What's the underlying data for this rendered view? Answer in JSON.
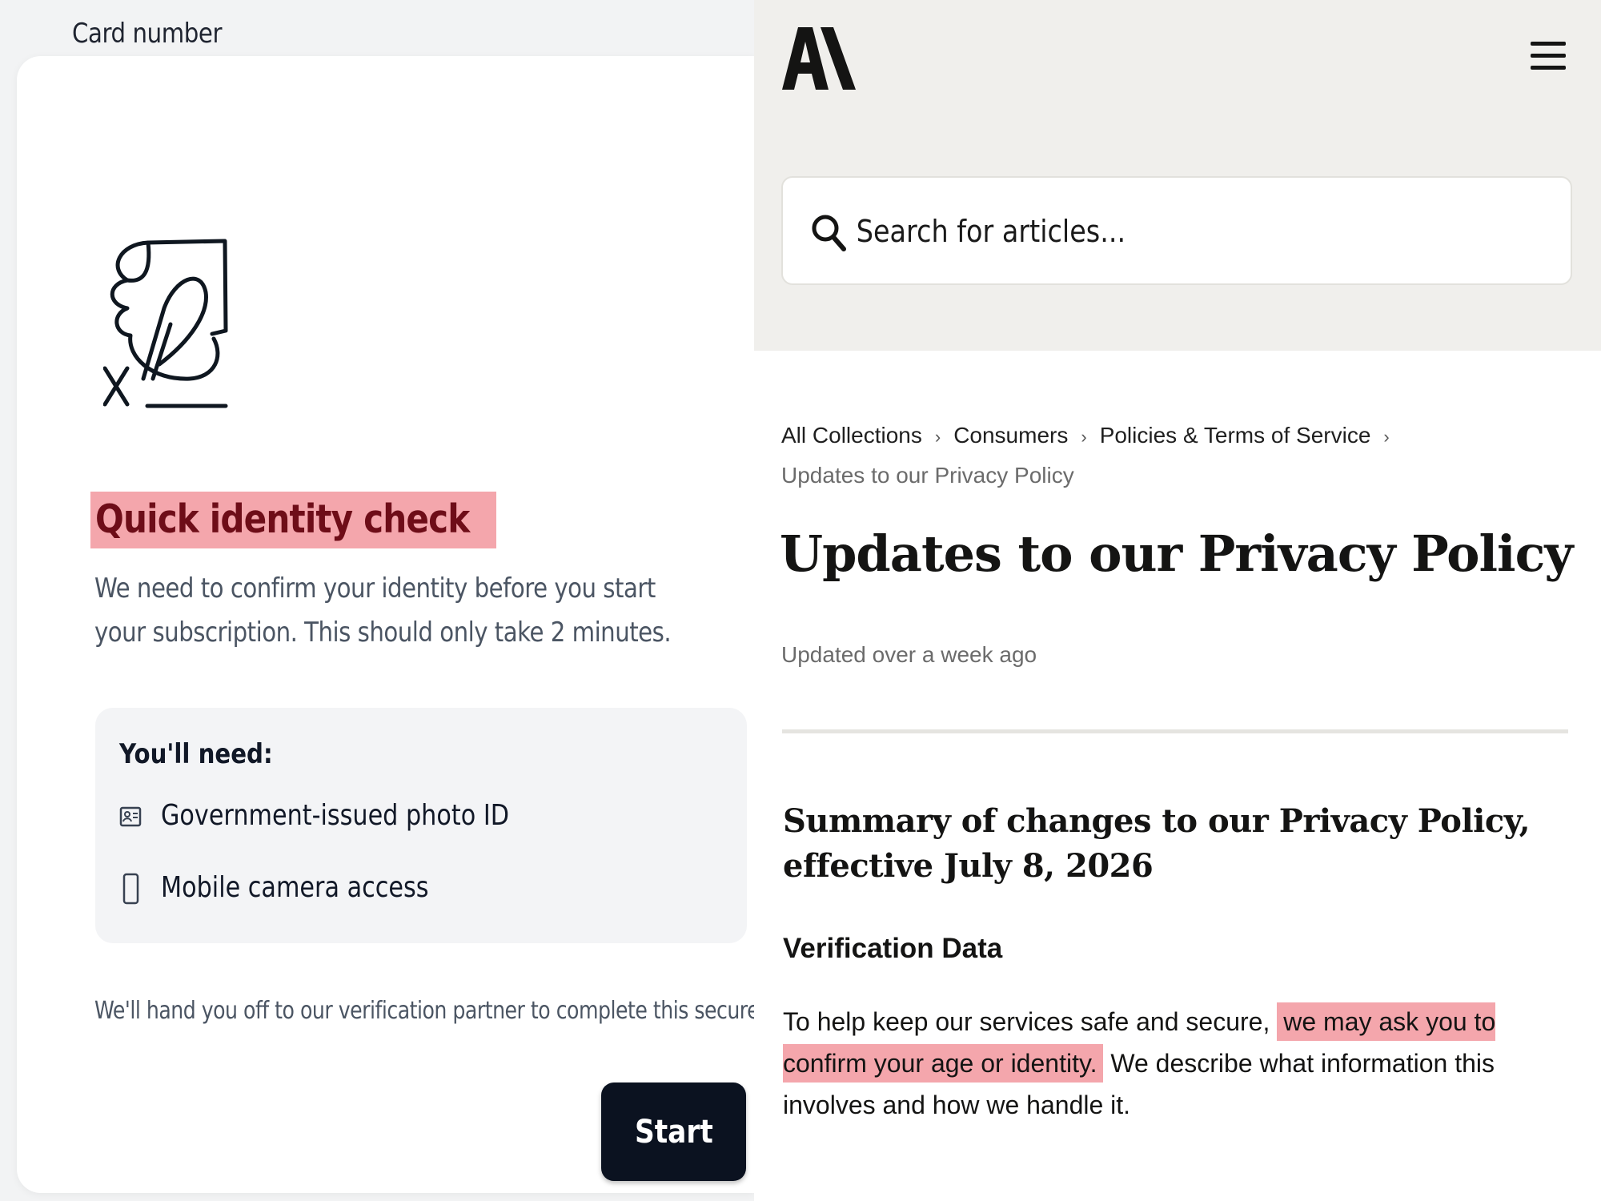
{
  "left_panel": {
    "card_number_label": "Card number",
    "title": "Quick identity check",
    "description": "We need to confirm your identity before you start your subscription. This should only take 2 minutes.",
    "needs": {
      "title": "You'll need:",
      "items": [
        {
          "icon": "id-card-icon",
          "label": "Government-issued photo ID"
        },
        {
          "icon": "phone-icon",
          "label": "Mobile camera access"
        }
      ]
    },
    "handoff_note": "We'll hand you off to our verification partner to complete this securely.",
    "start_label": "Start",
    "highlight_color": "#f4a6ac"
  },
  "right_panel": {
    "logo_icon": "anthropic-logo-icon",
    "search": {
      "placeholder": "Search for articles..."
    },
    "breadcrumbs": [
      "All Collections",
      "Consumers",
      "Policies & Terms of Service"
    ],
    "breadcrumb_current": "Updates to our Privacy Policy",
    "article_title": "Updates to our Privacy Policy",
    "updated": "Updated over a week ago",
    "summary_heading": "Summary of changes to our Privacy Policy, effective July 8, 2026",
    "section_heading": "Verification Data",
    "body": {
      "before": "To help keep our services safe and secure, ",
      "highlight": "we may ask you to confirm your age or identity.",
      "after": " We describe what information this involves and how we handle it."
    },
    "header_bg": "#f0efec"
  }
}
